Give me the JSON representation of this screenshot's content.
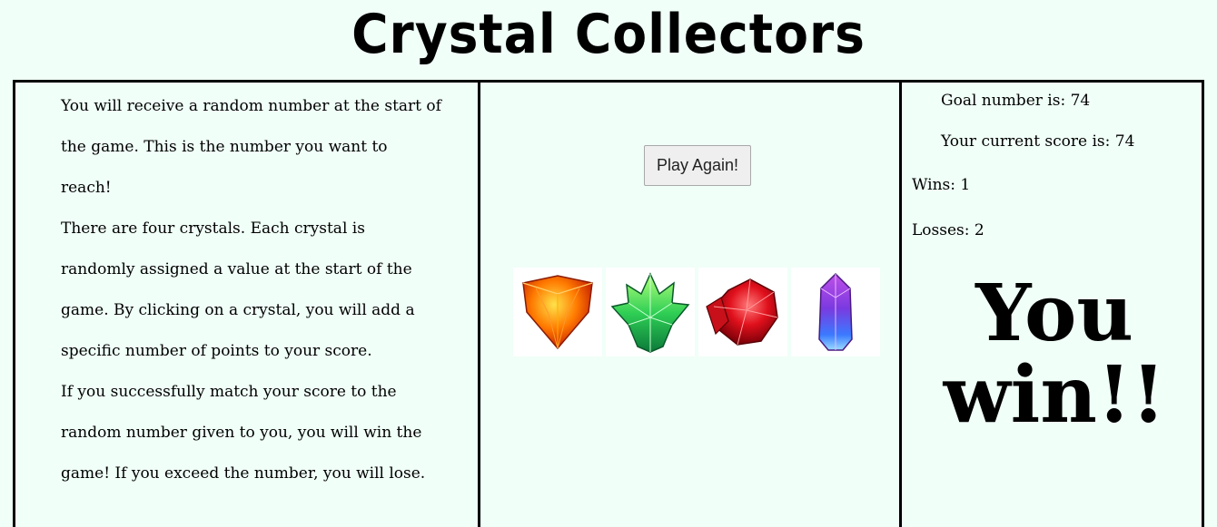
{
  "title": "Crystal Collectors",
  "instructions": [
    "You will receive a random number at the start of the game. This is the number you want to reach!",
    "There are four crystals. Each crystal is randomly assigned a value at the start of the game. By clicking on a crystal, you will add a specific number of points to your score.",
    "If you successfully match your score to the random number given to you, you will win the game! If you exceed the number, you will lose."
  ],
  "play_again_label": "Play Again!",
  "crystals": [
    {
      "name": "orange-crystal-icon",
      "color": "#ff6a00"
    },
    {
      "name": "green-crystal-icon",
      "color": "#37d34a"
    },
    {
      "name": "red-crystal-icon",
      "color": "#d6141c"
    },
    {
      "name": "purple-crystal-icon",
      "color": "#9b3ad8"
    }
  ],
  "stats": {
    "goal": "Goal number is: 74",
    "score": "Your current score is: 74",
    "wins": "Wins: 1",
    "losses": "Losses: 2"
  },
  "result_message": "You win!!"
}
